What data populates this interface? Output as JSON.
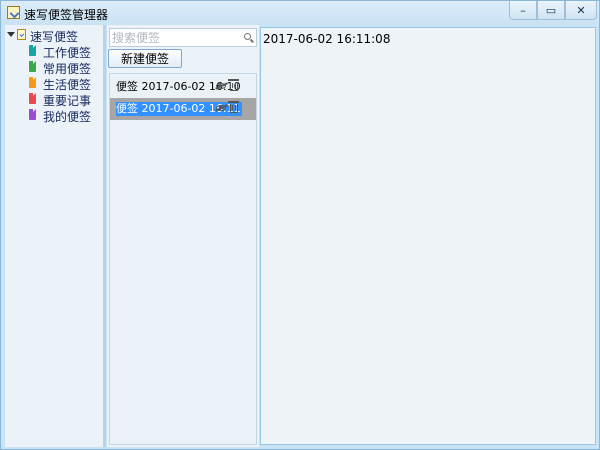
{
  "window": {
    "title": "速写便签管理器",
    "controls": {
      "minimize": "–",
      "maximize": "▭",
      "close": "✕"
    }
  },
  "tree": {
    "root": {
      "label": "速写便签",
      "icon": "notepad-icon"
    },
    "items": [
      {
        "label": "工作便签",
        "color": "#1aa3a3",
        "icon": "note-icon"
      },
      {
        "label": "常用便签",
        "color": "#3aa84a",
        "icon": "note-icon"
      },
      {
        "label": "生活便签",
        "color": "#f29a1e",
        "icon": "note-icon"
      },
      {
        "label": "重要记事",
        "color": "#e84a4a",
        "icon": "note-icon"
      },
      {
        "label": "我的便签",
        "color": "#9b4fd0",
        "icon": "note-icon"
      }
    ]
  },
  "list": {
    "search_placeholder": "搜索便签",
    "new_button": "新建便签",
    "notes": [
      {
        "title": "便签 2017-06-02 16:10",
        "selected": false
      },
      {
        "title": "便签 2017-06-02 16:11",
        "selected": true
      }
    ]
  },
  "content": {
    "text": "2017-06-02 16:11:08"
  },
  "colors": {
    "selection_highlight": "#3390ff",
    "selected_row": "#a6a6a6",
    "accent_border": "#99c6e4"
  }
}
